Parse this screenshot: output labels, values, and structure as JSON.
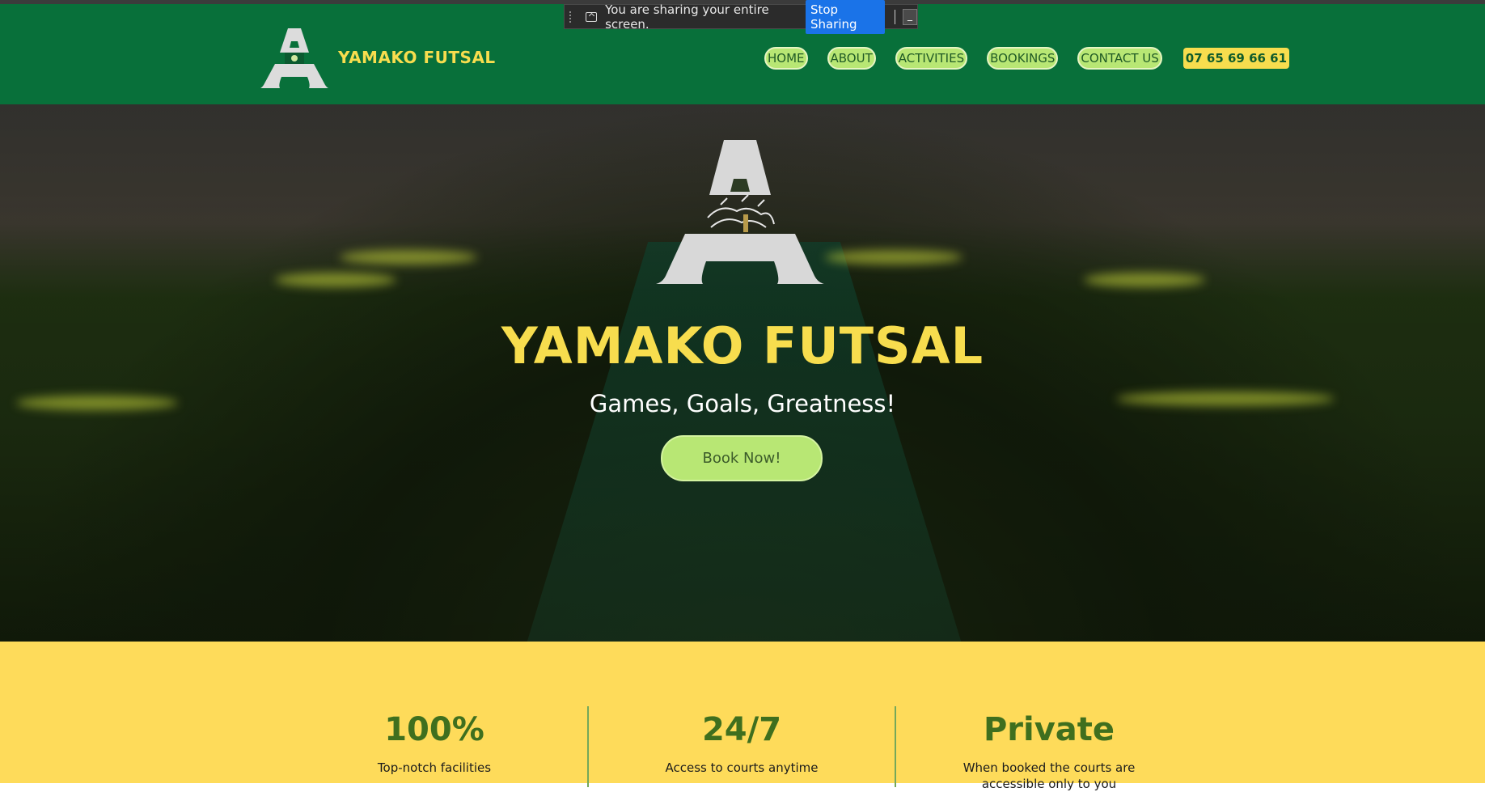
{
  "share_bar": {
    "message": "You are sharing your entire screen.",
    "stop_label": "Stop Sharing",
    "hide_label": "_"
  },
  "header": {
    "brand_name": "YAMAKO FUTSAL",
    "nav": [
      "HOME",
      "ABOUT",
      "ACTIVITIES",
      "BOOKINGS",
      "CONTACT US"
    ],
    "phone": "07 65 69 66 61"
  },
  "hero": {
    "title": "YAMAKO FUTSAL",
    "subtitle": "Games, Goals, Greatness!",
    "cta": "Book Now!"
  },
  "stats": [
    {
      "value": "100%",
      "description": "Top-notch facilities"
    },
    {
      "value": "24/7",
      "description": "Access to courts anytime"
    },
    {
      "value": "Private",
      "description": "When booked the courts are accessible only to you"
    }
  ],
  "colors": {
    "header_bg": "#08703a",
    "accent_yellow": "#f7dd4e",
    "button_green": "#b8e774",
    "stats_bg": "#fedb5a",
    "stat_text": "#3f6f1e"
  }
}
